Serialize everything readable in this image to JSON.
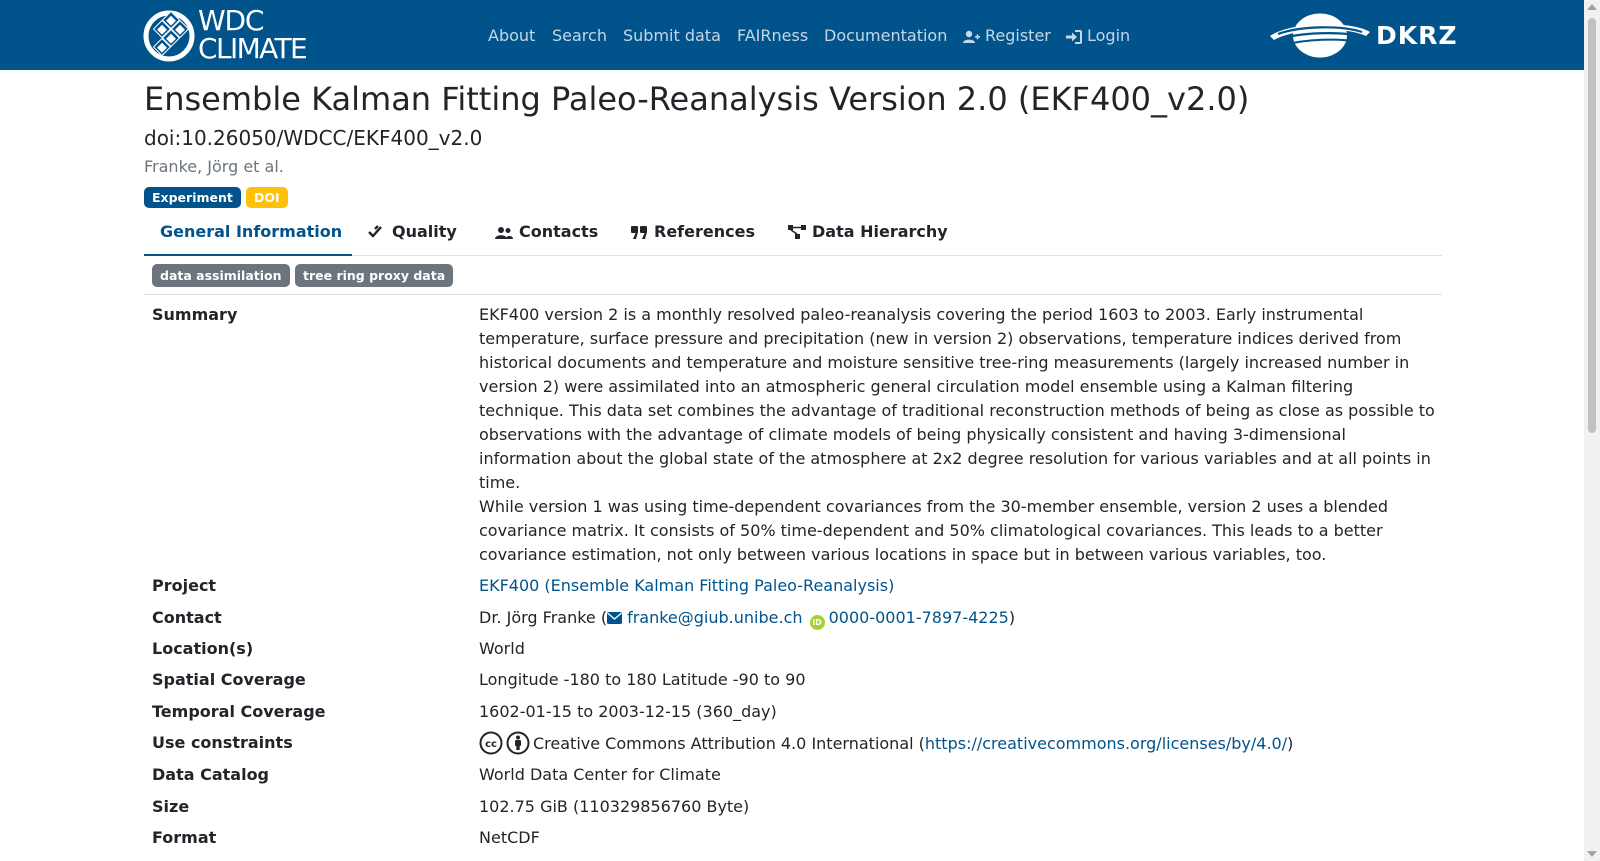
{
  "brand": {
    "line1": "WDC",
    "line2": "CLIMATE"
  },
  "nav": {
    "about": "About",
    "search": "Search",
    "submit": "Submit data",
    "fairness": "FAIRness",
    "documentation": "Documentation",
    "register": "Register",
    "login": "Login"
  },
  "partner_logo": "DKRZ",
  "header": {
    "title": "Ensemble Kalman Fitting Paleo-Reanalysis Version 2.0 (EKF400_v2.0)",
    "doi": "doi:10.26050/WDCC/EKF400_v2.0",
    "authors": "Franke, Jörg et al.",
    "badges": [
      "Experiment",
      "DOI"
    ]
  },
  "tabs": [
    "General Information",
    "Quality",
    "Contacts",
    "References",
    "Data Hierarchy"
  ],
  "active_tab": "General Information",
  "keywords": [
    "data assimilation",
    "tree ring proxy data"
  ],
  "details": {
    "summary_label": "Summary",
    "summary_p1": "EKF400 version 2 is a monthly resolved paleo-reanalysis covering the period 1603 to 2003. Early instrumental temperature, surface pressure and precipitation (new in version 2) observations, temperature indices derived from historical documents and temperature and moisture sensitive tree-ring measurements (largely increased number in version 2) were assimilated into an atmospheric general circulation model ensemble using a Kalman filtering technique. This data set combines the advantage of traditional reconstruction methods of being as close as possible to observations with the advantage of climate models of being physically consistent and having 3-dimensional information about the global state of the atmosphere at 2x2 degree resolution for various variables and at all points in time.",
    "summary_p2": "While version 1 was using time-dependent covariances from the 30-member ensemble, version 2 uses a blended covariance matrix. It consists of 50% time-dependent and 50% climatological covariances. This leads to a better covariance estimation, not only between various locations in space but in between various variables, too.",
    "project_label": "Project",
    "project_value": "EKF400 (Ensemble Kalman Fitting Paleo-Reanalysis)",
    "contact_label": "Contact",
    "contact_name": "Dr. Jörg Franke (",
    "contact_email": "franke@giub.unibe.ch",
    "contact_orcid": "0000-0001-7897-4225",
    "contact_close": ")",
    "location_label": "Location(s)",
    "location_value": "World",
    "spatial_label": "Spatial Coverage",
    "spatial_value": "Longitude -180 to 180 Latitude -90 to 90",
    "temporal_label": "Temporal Coverage",
    "temporal_value": "1602-01-15 to 2003-12-15 (360_day)",
    "use_label": "Use constraints",
    "use_value": "Creative Commons Attribution 4.0 International (",
    "use_link": "https://creativecommons.org/licenses/by/4.0/",
    "use_close": ")",
    "catalog_label": "Data Catalog",
    "catalog_value": "World Data Center for Climate",
    "size_label": "Size",
    "size_value": "102.75 GiB (110329856760 Byte)",
    "format_label": "Format",
    "format_value": "NetCDF"
  },
  "colors": {
    "primary": "#00538b",
    "doi_badge": "#ffc107",
    "keyword_badge": "#6c757d",
    "orcid": "#a6ce39"
  }
}
